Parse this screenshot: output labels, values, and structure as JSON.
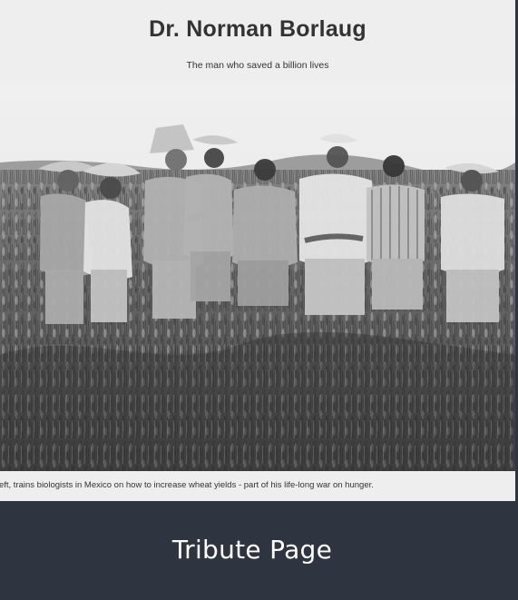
{
  "header": {
    "title": "Dr. Norman Borlaug",
    "subtitle": "The man who saved a billion lives"
  },
  "image": {
    "caption": "Dr. Norman Borlaug, third from the left, trains biologists in Mexico on how to increase wheat yields - part of his life-long war on hunger."
  },
  "footer": {
    "title": "Tribute Page"
  },
  "colors": {
    "card_background": "#eeeeee",
    "footer_background": "#2e3440",
    "text": "#333333",
    "footer_text": "#ffffff"
  }
}
